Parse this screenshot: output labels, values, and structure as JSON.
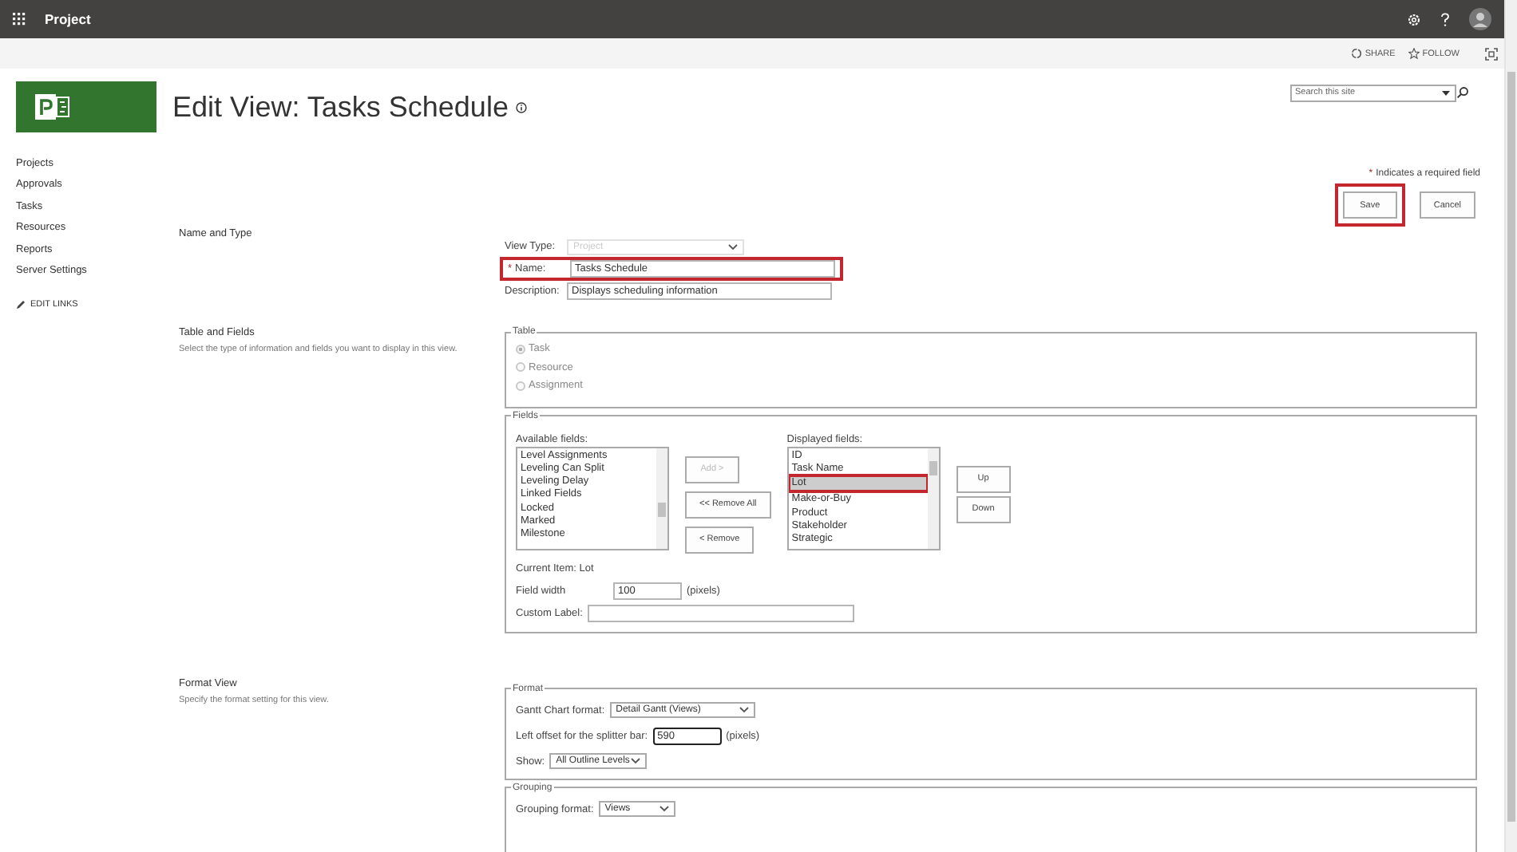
{
  "app_bar": {
    "title": "Project"
  },
  "page_actions": [
    {
      "label": "SHARE",
      "kind": "share"
    },
    {
      "label": "FOLLOW",
      "kind": "follow"
    }
  ],
  "search": {
    "placeholder": "Search this site"
  },
  "page_title": "Edit View: Tasks Schedule",
  "nav": {
    "items": [
      "Projects",
      "Approvals",
      "Tasks",
      "Resources",
      "Reports",
      "Server Settings"
    ],
    "edit_links": "EDIT LINKS"
  },
  "required_note": {
    "mark": "*",
    "text": "Indicates a required field"
  },
  "buttons": [
    {
      "label": "Save",
      "highlighted": true
    },
    {
      "label": "Cancel",
      "highlighted": false
    }
  ],
  "name_and_type": {
    "heading": "Name and Type",
    "view_type": {
      "label": "View Type:",
      "value": "Project",
      "disabled": true
    },
    "name": {
      "required_mark": "*",
      "label": "Name:",
      "value": "Tasks Schedule",
      "highlighted": true
    },
    "description": {
      "label": "Description:",
      "value": "Displays scheduling information"
    }
  },
  "table_and_fields": {
    "heading": "Table and Fields",
    "description": "Select the type of information and fields you want to display in this view.",
    "table": {
      "legend": "Table",
      "options": [
        {
          "label": "Task",
          "selected": true
        },
        {
          "label": "Resource",
          "selected": false
        },
        {
          "label": "Assignment",
          "selected": false
        }
      ]
    },
    "fields": {
      "legend": "Fields",
      "available_label": "Available fields:",
      "available": [
        "Level Assignments",
        "Leveling Can Split",
        "Leveling Delay",
        "Linked Fields",
        "Locked",
        "Marked",
        "Milestone"
      ],
      "add_button": {
        "label": "Add >",
        "disabled": true
      },
      "remove_all_button": {
        "label": "<< Remove All",
        "disabled": false
      },
      "remove_button": {
        "label": "< Remove",
        "disabled": false
      },
      "displayed_label": "Displayed fields:",
      "displayed": [
        {
          "label": "ID",
          "selected": false,
          "highlighted": false
        },
        {
          "label": "Task Name",
          "selected": false,
          "highlighted": false
        },
        {
          "label": "Lot",
          "selected": true,
          "highlighted": true
        },
        {
          "label": "Make-or-Buy",
          "selected": false,
          "highlighted": false
        },
        {
          "label": "Product",
          "selected": false,
          "highlighted": false
        },
        {
          "label": "Stakeholder",
          "selected": false,
          "highlighted": false
        },
        {
          "label": "Strategic",
          "selected": false,
          "highlighted": false
        }
      ],
      "up_button": "Up",
      "down_button": "Down",
      "current_item": "Current Item: Lot",
      "field_width": {
        "label": "Field width",
        "value": "100",
        "unit": "(pixels)"
      },
      "custom_label": {
        "label": "Custom Label:"
      }
    }
  },
  "format_view": {
    "heading": "Format View",
    "description": "Specify the format setting for this view.",
    "format": {
      "legend": "Format",
      "gantt": {
        "label": "Gantt Chart format:",
        "value": "Detail Gantt (Views)"
      },
      "splitter": {
        "label": "Left offset for the splitter bar:",
        "value": "590",
        "unit": "(pixels)"
      },
      "show": {
        "label": "Show:",
        "value": "All Outline Levels"
      }
    },
    "grouping": {
      "legend": "Grouping",
      "format": {
        "label": "Grouping format:",
        "value": "Views"
      }
    }
  }
}
